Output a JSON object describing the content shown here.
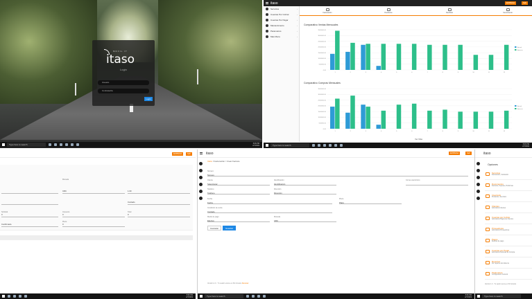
{
  "login": {
    "logo_sub": "MOVIL IT",
    "logo": "itaso",
    "title": "Login",
    "user_placeholder": "Usuario",
    "pass_placeholder": "Contraseña",
    "button": "Login"
  },
  "taskbar": {
    "search": "Type here to search",
    "time": "5:06 PM",
    "date": "2/7/2019"
  },
  "dashboard": {
    "brand": "itaso",
    "top_buttons": [
      "EMPRESA",
      "Salir"
    ],
    "sidebar": [
      {
        "label": "Servicios"
      },
      {
        "label": "Cuentas Por Cobrar"
      },
      {
        "label": "Cuentas Por Pagar"
      },
      {
        "label": "Mantenimiento"
      },
      {
        "label": "Parametros"
      },
      {
        "label": "Mas Menu"
      }
    ],
    "stats": [
      "Facturación",
      "Pendiente",
      "Recibido",
      "Vencimiento"
    ],
    "chart1_title": "Comparativo Ventas Mensuales",
    "chart2_title": "Comparativo Compras Mensuales",
    "legend": [
      "Actual",
      "Anterior"
    ],
    "bottom_label": "Ver Mas"
  },
  "chart_data": [
    {
      "type": "bar",
      "title": "Comparativo Ventas Mensuales",
      "categories": [
        "1",
        "2",
        "3",
        "4",
        "5",
        "6",
        "7",
        "8",
        "9",
        "10",
        "11",
        "12"
      ],
      "series": [
        {
          "name": "Actual",
          "values": [
            1.6,
            1.8,
            2.5,
            0.4,
            0,
            0,
            0,
            0,
            0,
            0,
            0,
            0
          ],
          "color": "#2e9bd6"
        },
        {
          "name": "Anterior",
          "values": [
            3.9,
            2.7,
            2.6,
            2.6,
            2.6,
            2.6,
            2.5,
            2.5,
            2.5,
            1.5,
            1.5,
            2.5
          ],
          "color": "#2dbf8a"
        }
      ],
      "y_ticks": [
        "0.00",
        "500000.00",
        "1000000.00",
        "1500000.00",
        "2000000.00",
        "2500000.00",
        "3000000.00",
        "3500000.00"
      ],
      "ylim": [
        0,
        4
      ]
    },
    {
      "type": "bar",
      "title": "Comparativo Compras Mensuales",
      "categories": [
        "1",
        "2",
        "3",
        "4",
        "5",
        "6",
        "7",
        "8",
        "9",
        "10",
        "11",
        "12"
      ],
      "series": [
        {
          "name": "Actual",
          "values": [
            2.2,
            1.6,
            2.4,
            0.4,
            0,
            0,
            0,
            0,
            0,
            0,
            0,
            0
          ],
          "color": "#2e9bd6"
        },
        {
          "name": "Anterior",
          "values": [
            3.0,
            3.3,
            2.2,
            1.8,
            2.4,
            2.5,
            1.8,
            1.9,
            1.7,
            1.7,
            1.7,
            1.8
          ],
          "color": "#2dbf8a"
        }
      ],
      "y_ticks": [
        "0.00",
        "500000.00",
        "1000000.00",
        "1500000.00",
        "2000000.00",
        "2500000.00",
        "3000000.00",
        "3500000.00"
      ],
      "ylim": [
        0,
        4
      ]
    }
  ],
  "form_left": {
    "buttons": [
      "Cancelar",
      "Guardar"
    ],
    "fields": [
      {
        "label": "Moneda",
        "value": ""
      },
      {
        "label": "",
        "value": "CRC"
      },
      {
        "label": "",
        "value": "1.00"
      },
      {
        "label": "",
        "value": "Contado"
      },
      {
        "label": "Subtotal",
        "value": "0"
      },
      {
        "label": "Impuesto",
        "value": "0"
      },
      {
        "label": "Total",
        "value": "0"
      },
      {
        "label": "",
        "value": "Confirmado"
      },
      {
        "label": "Plazo",
        "value": "0"
      }
    ]
  },
  "form_main": {
    "brand": "itaso",
    "top_buttons": [
      "EMPRESA",
      "Salir"
    ],
    "breadcrumb_start": "Inicio",
    "breadcrumb_mid": "Facturación",
    "breadcrumb_end": "Crear Factura",
    "fields": [
      {
        "label": "Número",
        "value": "Número"
      },
      {
        "label": "Cliente",
        "value": "Seleccionar"
      },
      {
        "label": "Identificación",
        "value": "Identificación"
      },
      {
        "label": "Correo electrónico",
        "value": ""
      },
      {
        "label": "Teléfono",
        "value": "Teléfono"
      },
      {
        "label": "Dirección",
        "value": "Dirección"
      },
      {
        "label": "Fecha",
        "value": "Fecha"
      },
      {
        "label": "Plazo",
        "value": "Plazo"
      },
      {
        "label": "Condición de venta",
        "value": "Contado"
      },
      {
        "label": "Medio de pago",
        "value": "Efectivo"
      },
      {
        "label": "Moneda",
        "value": "CRC"
      },
      {
        "label": "Tipo de cambio",
        "value": "1.00"
      }
    ],
    "btn_cancel": "Cancelar",
    "btn_save": "Guardar",
    "footer": "Versión 1.0 · Tu sesión vence en 60 minutos",
    "footer_link": "Renovar"
  },
  "options": {
    "brand": "itaso",
    "title": "Opciones",
    "items": [
      {
        "name": "Servicios",
        "desc": "Facturación, Cotización"
      },
      {
        "name": "Documentos",
        "desc": "Facturas, Tiquetes, Proformas"
      },
      {
        "name": "Inventario",
        "desc": "Productos, Servicios"
      },
      {
        "name": "Clientes",
        "desc": "Administrar clientes"
      },
      {
        "name": "Cuentas por Cobrar",
        "desc": "Administrar Pagos de Clientes"
      },
      {
        "name": "Proveedores",
        "desc": "Administrar Proveedores"
      },
      {
        "name": "Pagos",
        "desc": "Recibos de pago"
      },
      {
        "name": "Cuentas por Pagar",
        "desc": "Administrar Facturas de Compra"
      },
      {
        "name": "Reportes",
        "desc": "Ver reportes del sistema"
      },
      {
        "name": "Parámetros",
        "desc": "Configuración General"
      }
    ],
    "footer": "Versión 1.0 · Tu sesión vence en 60 minutos"
  }
}
